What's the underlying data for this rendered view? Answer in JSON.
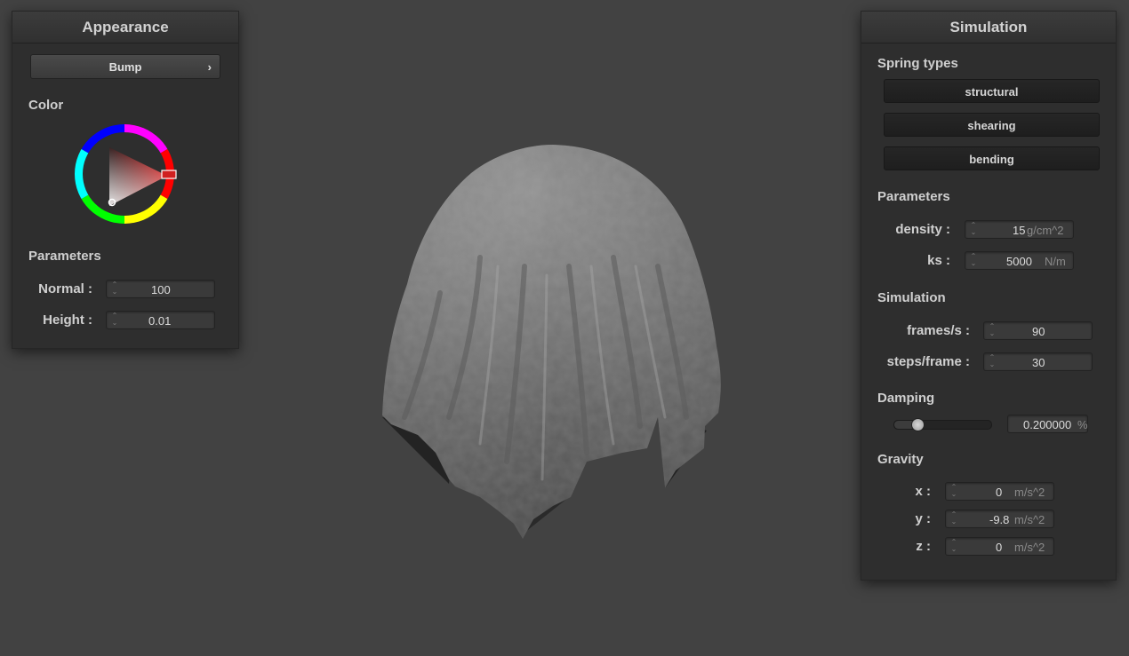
{
  "appearance": {
    "title": "Appearance",
    "shader_combo": {
      "label": "Bump",
      "arrow": "›"
    },
    "color_section": "Color",
    "color_value": "#cc3333",
    "params_section": "Parameters",
    "normal": {
      "label": "Normal :",
      "value": "100"
    },
    "height": {
      "label": "Height :",
      "value": "0.01"
    }
  },
  "simulation": {
    "title": "Simulation",
    "spring_section": "Spring types",
    "springs": [
      "structural",
      "shearing",
      "bending"
    ],
    "params_section": "Parameters",
    "density": {
      "label": "density :",
      "value": "15",
      "unit": "g/cm^2"
    },
    "ks": {
      "label": "ks :",
      "value": "5000",
      "unit": "N/m"
    },
    "sim_section": "Simulation",
    "fps": {
      "label": "frames/s :",
      "value": "90"
    },
    "steps": {
      "label": "steps/frame :",
      "value": "30"
    },
    "damping_section": "Damping",
    "damping": {
      "value": "0.200000",
      "unit": "%",
      "slider_fraction": 0.2
    },
    "gravity_section": "Gravity",
    "gravity": [
      {
        "label": "x :",
        "value": "0",
        "unit": "m/s^2"
      },
      {
        "label": "y :",
        "value": "-9.8",
        "unit": "m/s^2"
      },
      {
        "label": "z :",
        "value": "0",
        "unit": "m/s^2"
      }
    ]
  },
  "colors": {
    "background": "#424242",
    "panel": "#2e2e2e",
    "cloth": "#9a9a9a"
  }
}
